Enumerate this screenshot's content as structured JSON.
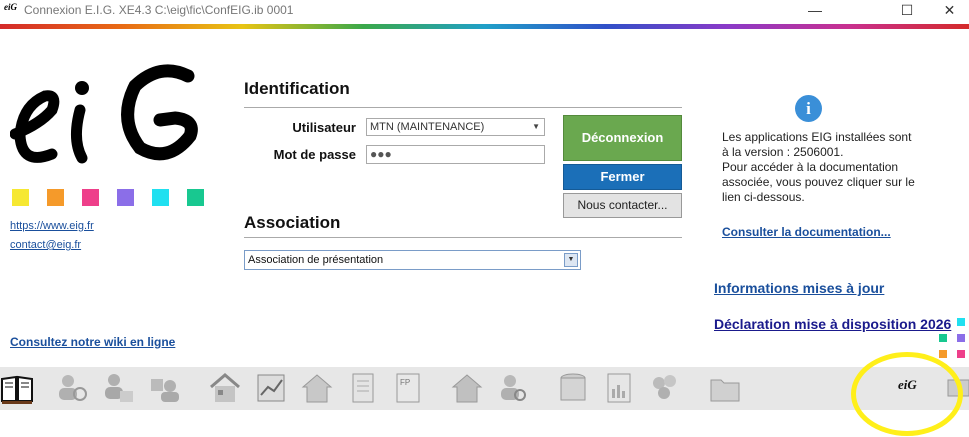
{
  "window": {
    "app_icon_text": "eiG",
    "title": "Connexion E.I.G. XE4.3 C:\\eig\\fic\\ConfEIG.ib 0001",
    "minimize": "—",
    "maximize": "☐",
    "close": "✕"
  },
  "brand": {
    "logo_text": "eiG",
    "swatch_colors": [
      "#f6e832",
      "#f59a2a",
      "#ee3f8a",
      "#8b6ee8",
      "#20e0f0",
      "#18c890"
    ],
    "website_link": "https://www.eig.fr",
    "email_link": "contact@eig.fr",
    "wiki_link": "Consultez notre wiki en ligne"
  },
  "identification": {
    "heading": "Identification",
    "user_label": "Utilisateur",
    "user_value": "MTN (MAINTENANCE)",
    "password_label": "Mot de passe",
    "password_value": "●●●",
    "disconnect_button": "Déconnexion",
    "close_button": "Fermer",
    "contact_button": "Nous contacter..."
  },
  "association": {
    "heading": "Association",
    "selected_value": "Association de présentation"
  },
  "info": {
    "icon": "i",
    "message": "Les applications EIG installées sont\nà la version : 2506001.\nPour accéder à la documentation\nassociée, vous pouvez cliquer sur le\nlien ci-dessous.",
    "doc_link": "Consulter la documentation...",
    "updates_link": "Informations mises à jour",
    "declaration_link": "Déclaration mise à disposition 2026"
  },
  "toolbar": {
    "icons": [
      "book-icon",
      "users-search-icon",
      "users-edit-icon",
      "group-icon",
      "house-building-icon",
      "chart-icon",
      "house-icon",
      "document-icon",
      "fp-document-icon",
      "house-color-icon",
      "user-search-icon",
      "database-icon",
      "report-icon",
      "coins-icon",
      "folder-icon"
    ],
    "fp_label": "FP",
    "eig_badge": "eiG"
  },
  "colors": {
    "accent_blue": "#1a4f9c",
    "green_button": "#6aa84f",
    "blue_button": "#1b6fb8",
    "highlight_yellow": "#ffef1a"
  }
}
